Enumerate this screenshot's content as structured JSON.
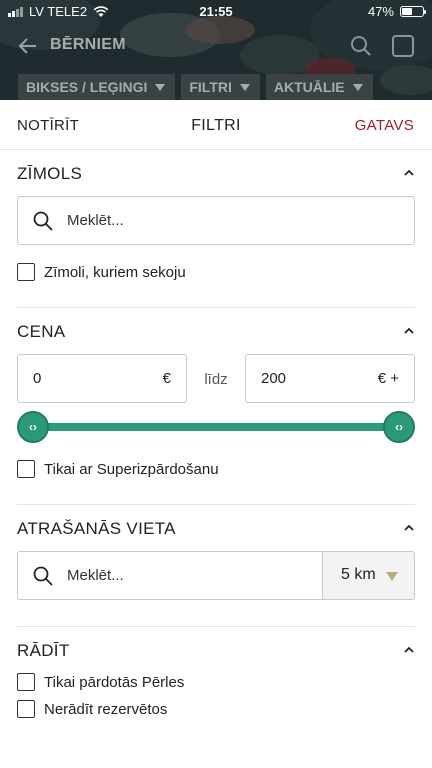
{
  "status_bar": {
    "carrier": "LV TELE2",
    "time": "21:55",
    "battery": "47%",
    "battery_level": 0.47
  },
  "navbar": {
    "title": "BĒRNIEM",
    "back_icon": "back-arrow-icon",
    "search_icon": "search-icon",
    "extra_icon": "square-icon"
  },
  "chips": [
    {
      "label": "BIKSES / LEĢINGI"
    },
    {
      "label": "FILTRI"
    },
    {
      "label": "AKTUĀLIE"
    }
  ],
  "sheet": {
    "clear_label": "NOTĪRĪT",
    "title": "FILTRI",
    "done_label": "GATAVS",
    "accent_color": "#a31d24"
  },
  "brand": {
    "title": "ZĪMOLS",
    "search_placeholder": "Meklēt...",
    "followed_label": "Zīmoli, kuriem sekoju",
    "followed_checked": false
  },
  "price": {
    "title": "CENA",
    "min_value": "0",
    "min_unit": "€",
    "until_label": "līdz",
    "max_value": "200",
    "max_unit": "€ +",
    "slider_color": "#2a9a7a",
    "slider_min_fraction": 0,
    "slider_max_fraction": 1,
    "super_sale_label": "Tikai ar Superizpārdošanu",
    "super_sale_checked": false
  },
  "location": {
    "title": "ATRAŠANĀS VIETA",
    "search_placeholder": "Meklēt...",
    "distance": "5 km"
  },
  "show": {
    "title": "RĀDĪT",
    "options": [
      {
        "label": "Tikai pārdotās Pērles",
        "checked": false
      },
      {
        "label": "Nerādīt rezervētos",
        "checked": false
      }
    ]
  }
}
